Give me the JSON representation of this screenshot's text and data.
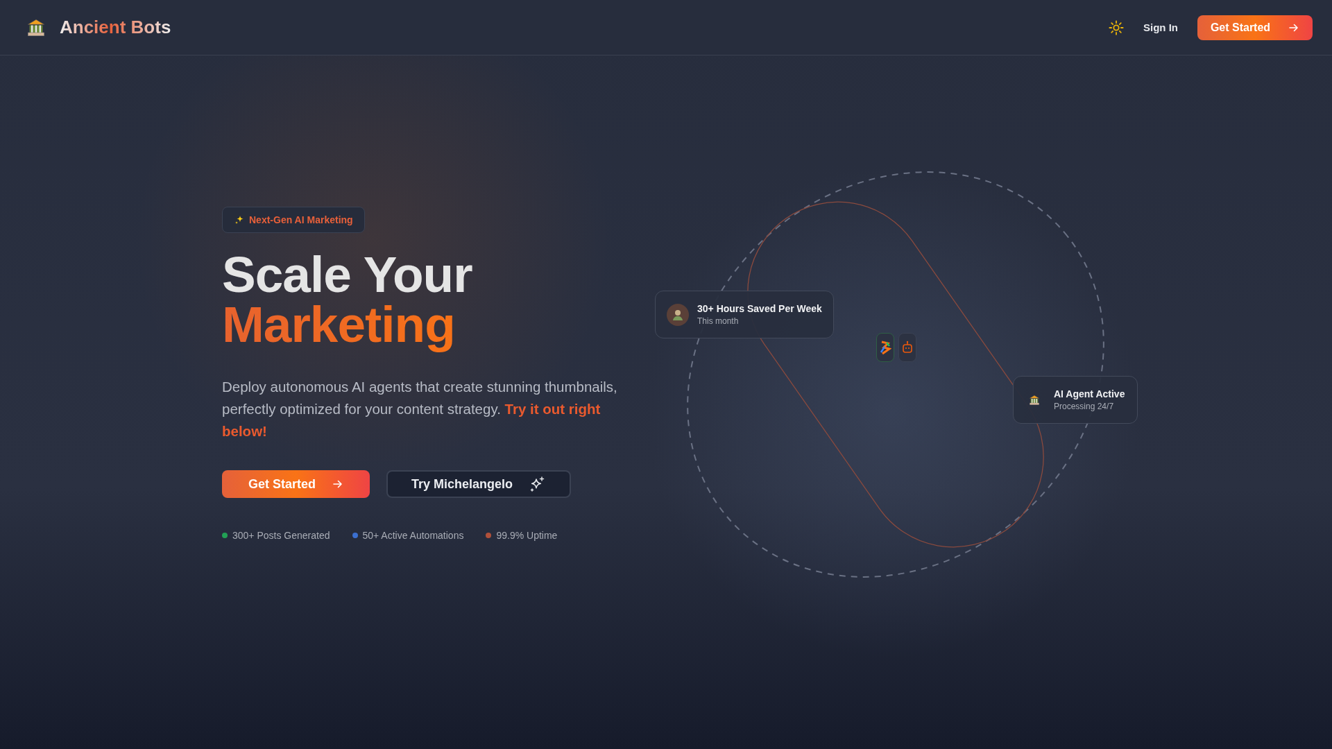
{
  "nav": {
    "brand": "Ancient Bots",
    "links": [
      {
        "label": "Sign In",
        "kind": "link"
      },
      {
        "label": "Get Started",
        "kind": "primary"
      }
    ]
  },
  "hero": {
    "badge": "Next-Gen AI Marketing",
    "title_lines": [
      "Scale Your",
      "Marketing"
    ],
    "description": "Deploy autonomous AI agents that create stunning thumbnails, perfectly optimized for your content strategy. **Try it out right below!**",
    "buttons": [
      {
        "label": "Get Started",
        "kind": "primary"
      },
      {
        "label": "Try Michelangelo",
        "kind": "secondary"
      }
    ],
    "stats": [
      {
        "label": "300+ Posts Generated",
        "color": "#22a055"
      },
      {
        "label": "50+ Active Automations",
        "color": "#3b6fd0"
      },
      {
        "label": "99.9% Uptime",
        "color": "#b0503a"
      }
    ]
  },
  "cards": [
    {
      "title": "30+ Hours Saved Per Week",
      "subtitle": "This month",
      "kind": "avatar"
    },
    {
      "title": "AI Agent Active",
      "subtitle": "Processing 24/7",
      "kind": "temple"
    }
  ]
}
